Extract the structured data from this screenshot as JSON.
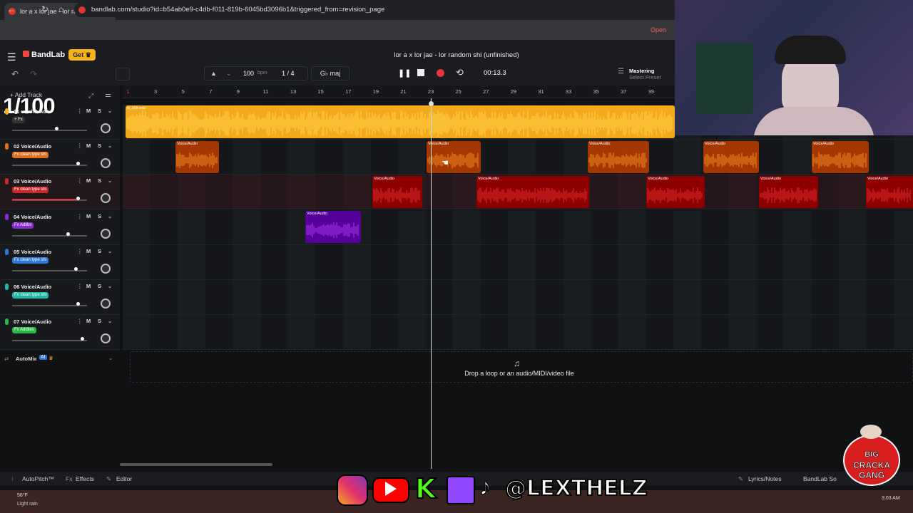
{
  "browser": {
    "tab_title": "lor a x lor jae - lor random",
    "tab_close": "×",
    "new_tab": "+",
    "url": "bandlab.com/studio?id=b54ab0e9-c4db-f011-819b-6045bd3096b1&triggered_from=revision_page",
    "open_badge": "Open"
  },
  "app": {
    "logo": "BandLab",
    "get_button": "Get",
    "project_title": "lor a x lor jae - lor random shi (unfinished)",
    "bpm": "100",
    "bpm_unit": "bpm",
    "time_signature": "1 / 4",
    "key": "G♭ maj",
    "time_display": "00:13.3",
    "mastering_title": "Mastering",
    "mastering_sub": "Select Preset",
    "add_track": "Add Track",
    "overlay_counter": "1/100"
  },
  "ruler": [
    "1",
    "3",
    "5",
    "7",
    "9",
    "11",
    "13",
    "15",
    "17",
    "19",
    "21",
    "23",
    "25",
    "27",
    "29",
    "31",
    "33",
    "35",
    "37",
    "39"
  ],
  "tracks": [
    {
      "num": "01",
      "name": "w_shit.wav",
      "fx": "+ Fx",
      "fx_color": "#333333",
      "mic_color": "#f5b21b",
      "volume": 0.57
    },
    {
      "num": "02",
      "name": "Voice/Audio",
      "fx": "Fx clean type shi",
      "fx_color": "#e07020",
      "mic_color": "#e07020",
      "volume": 0.86
    },
    {
      "num": "03",
      "name": "Voice/Audio",
      "fx": "Fx clean type shi",
      "fx_color": "#cc2a2a",
      "mic_color": "#cc2a2a",
      "volume": 0.86
    },
    {
      "num": "04",
      "name": "Voice/Audio",
      "fx": "Fx Adlibs",
      "fx_color": "#8a2ad0",
      "mic_color": "#8a2ad0",
      "volume": 0.72
    },
    {
      "num": "05",
      "name": "Voice/Audio",
      "fx": "Fx clean type shi",
      "fx_color": "#2a78d8",
      "mic_color": "#2a78d8",
      "volume": 0.83
    },
    {
      "num": "06",
      "name": "Voice/Audio",
      "fx": "Fx clean type shi",
      "fx_color": "#1fb8a8",
      "mic_color": "#1fb8a8",
      "volume": 0.86
    },
    {
      "num": "07",
      "name": "Voice/Audio",
      "fx": "Fx Addlies",
      "fx_color": "#2ab84a",
      "mic_color": "#2ab84a",
      "volume": 0.91
    }
  ],
  "clips": {
    "track1": {
      "label": "w_shit.wav",
      "color": "#f2a91c"
    },
    "track2": {
      "label": "Voice/Audio",
      "color": "#e87d20"
    },
    "track3": {
      "label": "Voice/Audio",
      "color": "#d42424"
    },
    "track4": {
      "label": "Voice/Audio",
      "color": "#9b2fe0"
    }
  },
  "automix": {
    "label": "AutoMix",
    "badge": "AI"
  },
  "dropzone": {
    "text": "Drop a loop or an audio/MIDI/video file"
  },
  "bottom": {
    "autopitch": "AutoPitch™",
    "effects": "Effects",
    "editor": "Editor",
    "lyrics": "Lyrics/Notes",
    "bandlab_sounds": "BandLab So"
  },
  "overlay": {
    "social_handle": "@LEXTHELZ",
    "badge_line1": "BIG",
    "badge_line2": "CRACKA",
    "badge_line3": "GANG"
  },
  "taskbar": {
    "weather": "56°F",
    "weather_sub": "Light rain",
    "time": "3:03 AM"
  }
}
